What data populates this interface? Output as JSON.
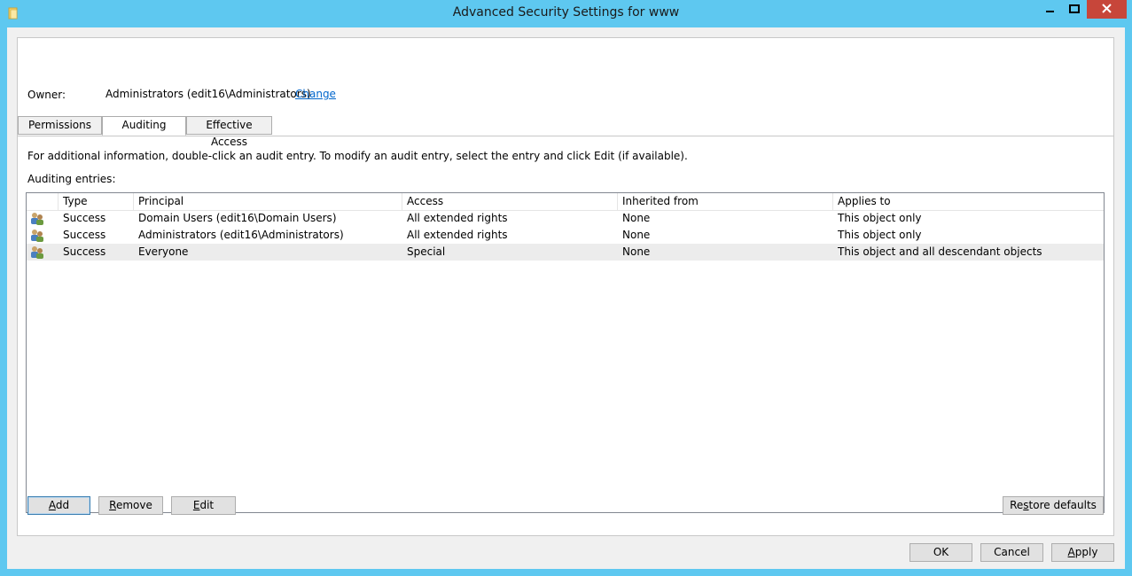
{
  "window": {
    "title": "Advanced Security Settings for www"
  },
  "owner": {
    "label": "Owner:",
    "value": "Administrators (edit16\\Administrators)",
    "change_link": "Change"
  },
  "tabs": [
    {
      "label": "Permissions",
      "active": false
    },
    {
      "label": "Auditing",
      "active": true
    },
    {
      "label": "Effective Access",
      "active": false
    }
  ],
  "info_text": "For additional information, double-click an audit entry. To modify an audit entry, select the entry and click Edit (if available).",
  "entries_label": "Auditing entries:",
  "table": {
    "columns": [
      "Type",
      "Principal",
      "Access",
      "Inherited from",
      "Applies to"
    ],
    "rows": [
      {
        "type": "Success",
        "principal": "Domain Users (edit16\\Domain Users)",
        "access": "All extended rights",
        "inherited": "None",
        "applies": "This object only",
        "icon": "users-icon"
      },
      {
        "type": "Success",
        "principal": "Administrators (edit16\\Administrators)",
        "access": "All extended rights",
        "inherited": "None",
        "applies": "This object only",
        "icon": "users-icon"
      },
      {
        "type": "Success",
        "principal": "Everyone",
        "access": "Special",
        "inherited": "None",
        "applies": "This object and all descendant objects",
        "icon": "users-icon"
      }
    ]
  },
  "buttons": {
    "add": {
      "mnemonic": "A",
      "rest": "dd"
    },
    "remove": {
      "mnemonic": "R",
      "rest": "emove"
    },
    "edit": {
      "mnemonic": "E",
      "rest": "dit"
    },
    "restore": {
      "pre": "Re",
      "mnemonic": "s",
      "rest": "tore defaults"
    },
    "ok": "OK",
    "cancel": "Cancel",
    "apply": {
      "mnemonic": "A",
      "rest": "pply"
    }
  },
  "colors": {
    "titlebar": "#5ec8f0",
    "close": "#c7463a",
    "link": "#0066cc",
    "selected_row": "#ececec"
  }
}
